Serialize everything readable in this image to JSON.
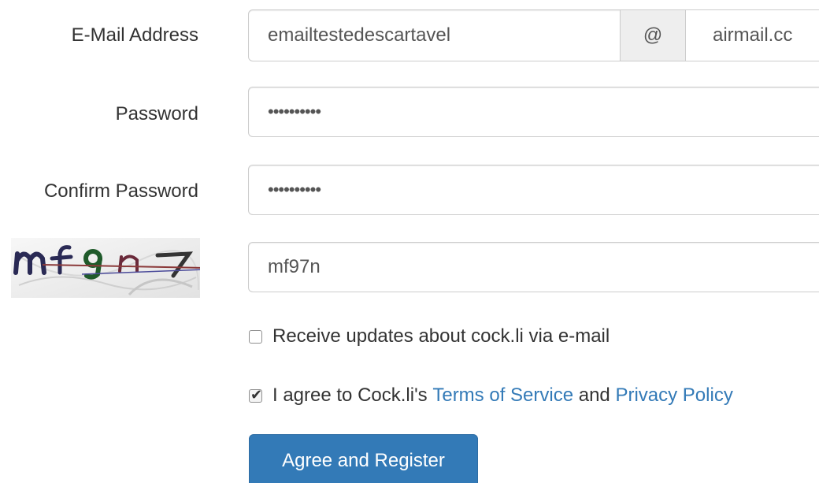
{
  "form": {
    "email": {
      "label": "E-Mail Address",
      "value": "emailtestedescartavel",
      "at": "@",
      "domain": "airmail.cc"
    },
    "password": {
      "label": "Password",
      "value": "••••••••••"
    },
    "confirm_password": {
      "label": "Confirm Password",
      "value": "••••••••••"
    },
    "captcha": {
      "value": "mf97n"
    },
    "updates_checkbox": {
      "checked": false,
      "label": "Receive updates about cock.li via e-mail"
    },
    "agree_checkbox": {
      "checked": true,
      "text_before": "I agree to Cock.li's",
      "tos_link": "Terms of Service",
      "text_and": "and",
      "privacy_link": "Privacy Policy"
    },
    "submit_label": "Agree and Register"
  },
  "colors": {
    "primary": "#337ab7",
    "link": "#337ab7",
    "border": "#cccccc",
    "addon_bg": "#eeeeee"
  }
}
